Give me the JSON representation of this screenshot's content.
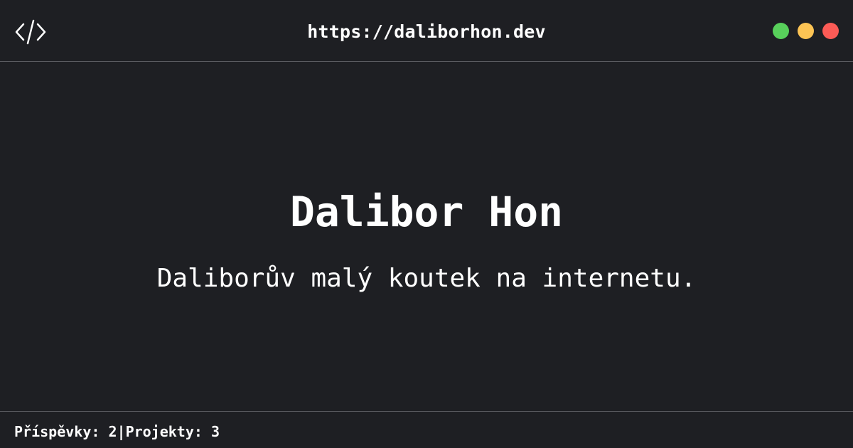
{
  "header": {
    "url": "https://daliborhon.dev",
    "icon": "code-icon",
    "window_controls": [
      {
        "name": "green-dot",
        "color": "#58d05b"
      },
      {
        "name": "yellow-dot",
        "color": "#fdc454"
      },
      {
        "name": "red-dot",
        "color": "#fc5b56"
      }
    ]
  },
  "main": {
    "title": "Dalibor Hon",
    "subtitle": "Daliborův malý koutek na internetu."
  },
  "footer": {
    "posts_label": "Příspěvky:",
    "posts_count": "2",
    "separator": "|",
    "projects_label": "Projekty:",
    "projects_count": "3"
  },
  "colors": {
    "background": "#1e1f23",
    "text": "#ffffff",
    "divider": "#5a5b60"
  }
}
